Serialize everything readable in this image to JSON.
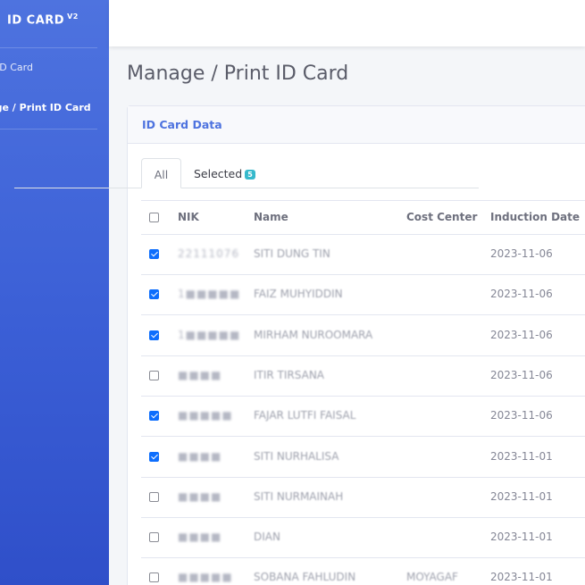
{
  "sidebar": {
    "brand": "ID CARD",
    "brand_version": "V2",
    "items": [
      {
        "label": "ID Card"
      },
      {
        "label": "Manage / Print ID Card"
      }
    ]
  },
  "page": {
    "title": "Manage / Print ID Card"
  },
  "card": {
    "header": "ID Card Data"
  },
  "tabs": [
    {
      "label": "All"
    },
    {
      "label": "Selected",
      "badge": "5"
    }
  ],
  "table": {
    "headers": [
      "NIK",
      "Name",
      "Cost Center",
      "Induction Date"
    ],
    "rows": [
      {
        "checked": true,
        "nik": "22111076",
        "name": "SITI DUNG TIN",
        "cost_center": "",
        "date": "2023-11-06"
      },
      {
        "checked": true,
        "nik": "1■■■■■",
        "name": "FAIZ MUHYIDDIN",
        "cost_center": "",
        "date": "2023-11-06"
      },
      {
        "checked": true,
        "nik": "1■■■■■",
        "name": "MIRHAM NUROOMARA",
        "cost_center": "",
        "date": "2023-11-06"
      },
      {
        "checked": false,
        "nik": "■■■■",
        "name": "ITIR TIRSANA",
        "cost_center": "",
        "date": "2023-11-06"
      },
      {
        "checked": true,
        "nik": "■■■■■",
        "name": "FAJAR LUTFI FAISAL",
        "cost_center": "",
        "date": "2023-11-06"
      },
      {
        "checked": true,
        "nik": "■■■■",
        "name": "SITI NURHALISA",
        "cost_center": "",
        "date": "2023-11-01"
      },
      {
        "checked": false,
        "nik": "■■■■",
        "name": "SITI NURMAINAH",
        "cost_center": "",
        "date": "2023-11-01"
      },
      {
        "checked": false,
        "nik": "■■■■",
        "name": "DIAN",
        "cost_center": "",
        "date": "2023-11-01"
      },
      {
        "checked": false,
        "nik": "■■■■■",
        "name": "SOBANA FAHLUDIN",
        "cost_center": "MOYAGAF",
        "date": "2023-11-01"
      }
    ]
  },
  "colors": {
    "primary": "#4e73df",
    "checkbox_checked": "#0d6efd",
    "badge": "#36b9cc"
  }
}
